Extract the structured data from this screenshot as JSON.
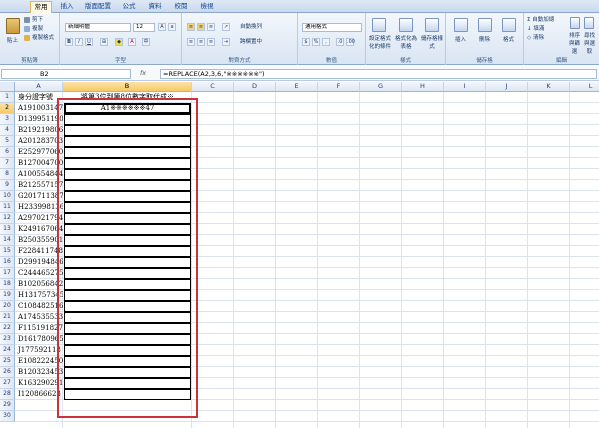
{
  "ribbon": {
    "tabs": [
      "常用",
      "插入",
      "版面配置",
      "公式",
      "資料",
      "校閱",
      "檢視"
    ],
    "groups": {
      "clipboard": {
        "label": "剪貼簿",
        "paste": "貼上",
        "cut": "剪下",
        "copy": "複製",
        "format_painter": "複製格式"
      },
      "font": {
        "label": "字型",
        "font_name": "新細明體",
        "font_size": "12"
      },
      "alignment": {
        "label": "對齊方式",
        "wrap": "自動換列",
        "merge": "跨欄置中"
      },
      "number": {
        "label": "數值",
        "format": "通用格式"
      },
      "styles": {
        "label": "樣式",
        "conditional": "設定格式化的條件",
        "as_table": "格式化為表格",
        "cell_styles": "儲存格樣式"
      },
      "cells": {
        "label": "儲存格",
        "insert": "插入",
        "delete": "刪除",
        "format": "格式"
      },
      "editing": {
        "label": "編輯",
        "autosum": "自動加總",
        "fill": "填滿",
        "clear": "清除",
        "sort": "排序與篩選",
        "find": "尋找與選取"
      }
    }
  },
  "formula_bar": {
    "name_box": "B2",
    "fx": "fx",
    "formula": "=REPLACE(A2,3,6,\"※※※※※※\")"
  },
  "sheet": {
    "columns": [
      "A",
      "B",
      "C",
      "D",
      "E",
      "F",
      "G",
      "H",
      "I",
      "J",
      "K",
      "L",
      "M"
    ],
    "selected_column": "B",
    "selected_row": 2,
    "header_a": "身分證字號",
    "header_b": "將第3位到第8位數字取代成※",
    "rows_a": [
      "A191003147",
      "D139951190",
      "B219219806",
      "A201283703",
      "E252977060",
      "B127004700",
      "A100554844",
      "B212557157",
      "G201711387",
      "H233998136",
      "A297021794",
      "K249167064",
      "B250355901",
      "F228411748",
      "D299194846",
      "C244465275",
      "B102056842",
      "H131757345",
      "C108482516",
      "A174535533",
      "F115191827",
      "D161780965",
      "J177592118",
      "E108222450",
      "B120323453",
      "K163290291",
      "I120866623"
    ],
    "b2_value": "A1※※※※※※47",
    "row_numbers": [
      "1",
      "2",
      "3",
      "4",
      "5",
      "6",
      "7",
      "8",
      "9",
      "10",
      "11",
      "12",
      "13",
      "14",
      "15",
      "16",
      "17",
      "18",
      "19",
      "20",
      "21",
      "22",
      "23",
      "24",
      "25",
      "26",
      "27",
      "28",
      "29",
      "30"
    ]
  }
}
